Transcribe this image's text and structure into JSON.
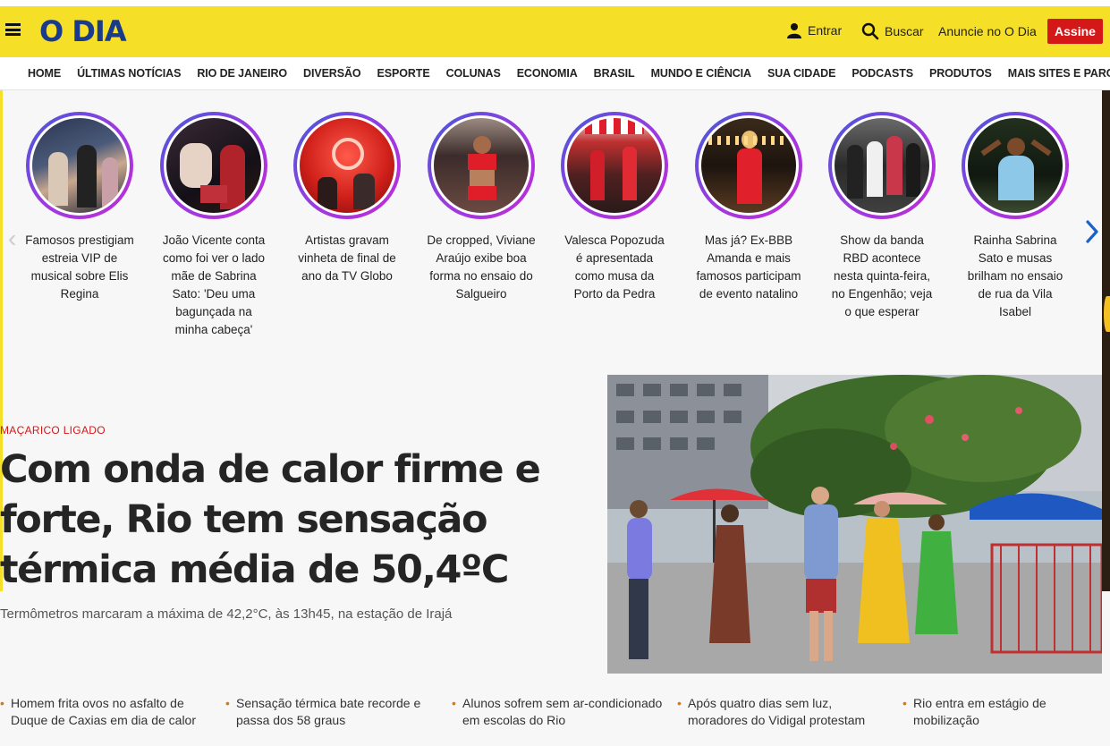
{
  "header": {
    "logo": "O DIA",
    "entrar": "Entrar",
    "buscar": "Buscar",
    "anuncie": "Anuncie no O Dia",
    "assine": "Assine"
  },
  "nav": [
    "HOME",
    "ÚLTIMAS NOTÍCIAS",
    "RIO DE JANEIRO",
    "DIVERSÃO",
    "ESPORTE",
    "COLUNAS",
    "ECONOMIA",
    "BRASIL",
    "MUNDO E CIÊNCIA",
    "SUA CIDADE",
    "PODCASTS",
    "PRODUTOS",
    "MAIS SITES E PARCEIROS"
  ],
  "stories": [
    {
      "caption": "Famosos prestigiam estreia VIP de musical sobre Elis Regina"
    },
    {
      "caption": "João Vicente conta como foi ver o lado mãe de Sabrina Sato: 'Deu uma bagunçada na minha cabeça'"
    },
    {
      "caption": "Artistas gravam vinheta de final de ano da TV Globo"
    },
    {
      "caption": "De cropped, Viviane Araújo exibe boa forma no ensaio do Salgueiro"
    },
    {
      "caption": "Valesca Popozuda é apresentada como musa da Porto da Pedra"
    },
    {
      "caption": "Mas já? Ex-BBB Amanda e mais famosos participam de evento natalino"
    },
    {
      "caption": "Show da banda RBD acontece nesta quinta-feira, no Engenhão; veja o que esperar"
    },
    {
      "caption": "Rainha Sabrina Sato e musas brilham no ensaio de rua da Vila Isabel"
    }
  ],
  "main": {
    "kicker": "MAÇARICO LIGADO",
    "headline": "Com onda de calor firme e forte, Rio tem sensação térmica média de 50,4ºC",
    "subline": "Termômetros marcaram a máxima de 42,2°C, às 13h45, na estação de Irajá"
  },
  "related": [
    "Homem frita ovos no asfalto de Duque de Caxias em dia de calor",
    "Sensação térmica bate recorde e passa dos 58 graus",
    "Alunos sofrem sem ar-condicionado em escolas do Rio",
    "Após quatro dias sem luz, moradores do Vidigal protestam",
    "Rio entra em estágio de mobilização"
  ],
  "colors": {
    "brand_yellow": "#f5df27",
    "logo_blue": "#1a3a8c",
    "accent_red": "#d41818"
  }
}
